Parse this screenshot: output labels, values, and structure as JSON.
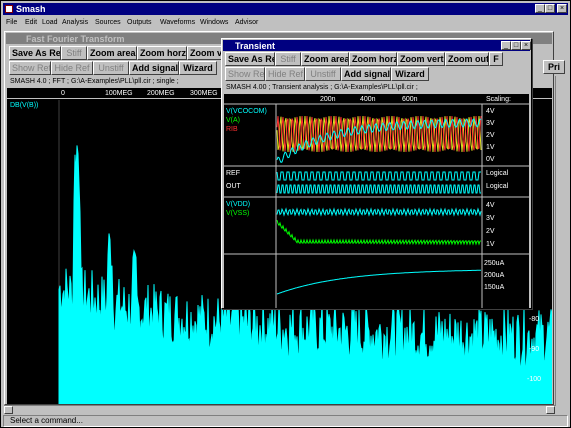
{
  "app": {
    "title": "Smash"
  },
  "menu": [
    "File",
    "Edit",
    "Load",
    "Analysis",
    "Sources",
    "Outputs",
    "Waveforms",
    "Windows",
    "Advisor"
  ],
  "fft_window": {
    "title": "Fast Fourier Transform",
    "toolbar_row1": [
      "Save As Ref",
      "Stiff",
      "Zoom area",
      "Zoom horz",
      "Zoom v"
    ],
    "toolbar_row2": [
      "Show Ref",
      "Hide Ref",
      "Unstiff",
      "Add signal",
      "Wizard"
    ],
    "info": "SMASH 4.0 ; FFT ; G:\\A-Examples\\PLL\\pll.cir ; single ;",
    "x_ticks": [
      "0",
      "100MEG",
      "200MEG",
      "300MEG"
    ],
    "signal": "DB(V(B))",
    "y_ticks": [
      "-80",
      "-90",
      "-100"
    ]
  },
  "transient_window": {
    "title": "Transient",
    "toolbar_row1": [
      "Save As Ref",
      "Stiff",
      "Zoom area",
      "Zoom horz",
      "Zoom vert",
      "Zoom out",
      "F"
    ],
    "toolbar_row2": [
      "Show Ref",
      "Hide Ref",
      "Unstiff",
      "Add signal",
      "Wizard"
    ],
    "info": "SMASH 4.00 ; Transient analysis ; G:\\A-Examples\\PLL\\pll.cir ;",
    "time_ticks": [
      "200n",
      "400n",
      "600n"
    ],
    "scaling_label": "Scaling:",
    "pane1": {
      "signals": [
        "V(VCOCOM)",
        "V(A)",
        "RIB"
      ],
      "scale": [
        "4V",
        "3V",
        "2V",
        "1V",
        "0V"
      ]
    },
    "pane2": {
      "signals": [
        "REF",
        "OUT"
      ],
      "scale": [
        "Logical",
        "Logical"
      ]
    },
    "pane3": {
      "signals": [
        "V(VDD)",
        "V(VSS)"
      ],
      "scale": [
        "4V",
        "3V",
        "2V",
        "1V"
      ]
    },
    "pane4": {
      "scale": [
        "250uA",
        "200uA",
        "150uA"
      ]
    }
  },
  "side_buttons": [
    "Pri"
  ],
  "status_bar": "Select a command...",
  "colors": {
    "titlebar": "#000080",
    "desktop": "#008080",
    "face": "#c0c0c0",
    "trace_cyan": "#00ffff",
    "trace_green": "#00ff00",
    "trace_red": "#ff3030",
    "trace_yellow": "#e0e020"
  }
}
